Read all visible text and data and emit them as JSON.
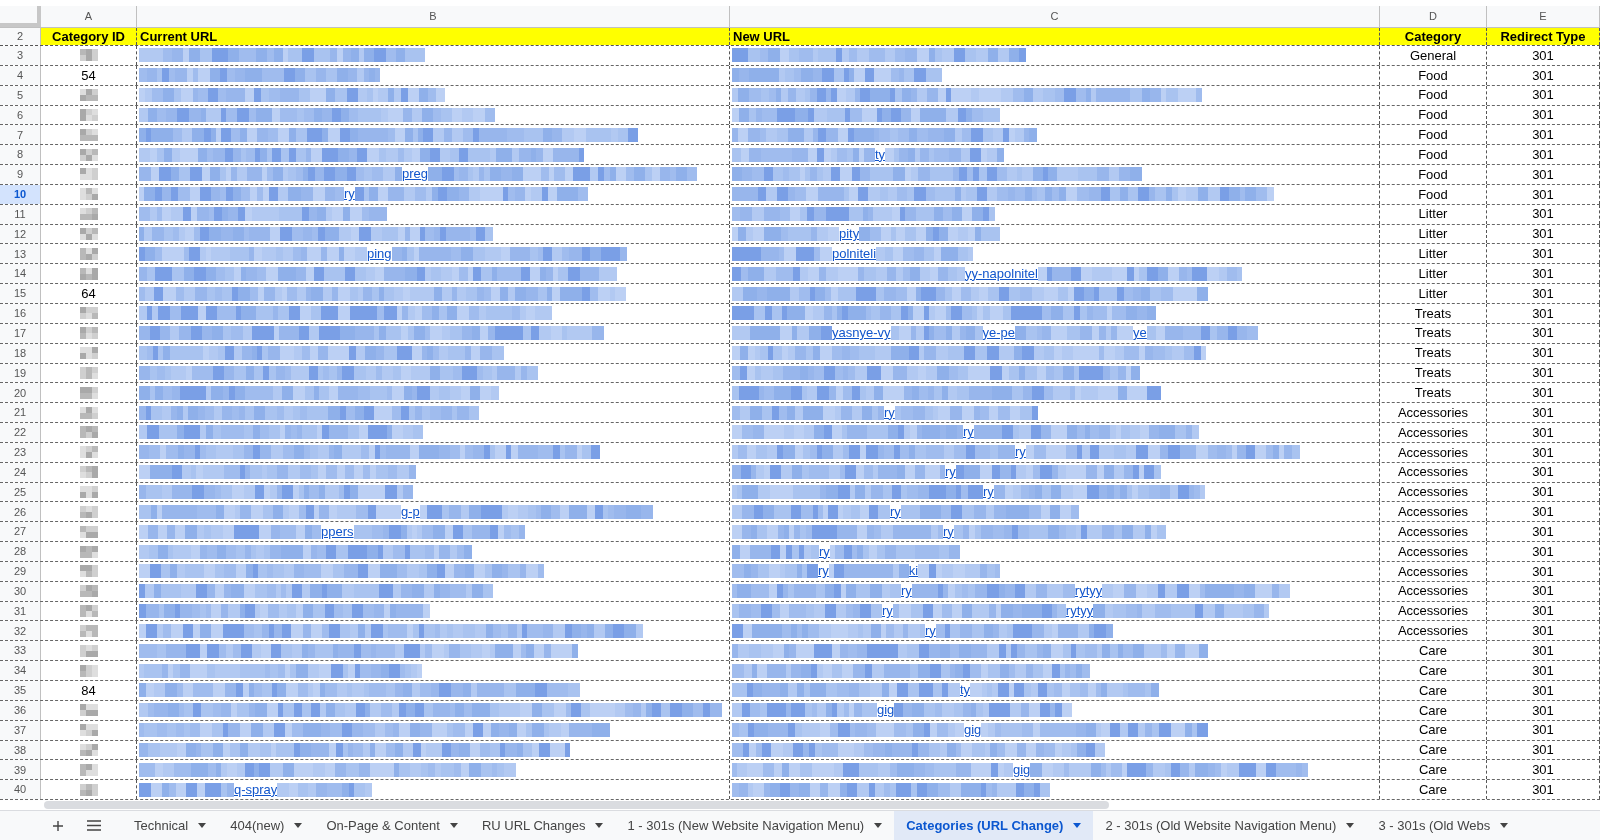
{
  "columns": [
    "A",
    "B",
    "C",
    "D",
    "E"
  ],
  "header": {
    "row": "2",
    "cells": [
      "Category ID",
      "Current URL",
      "New URL",
      "Category",
      "Redirect Type"
    ]
  },
  "rows": [
    {
      "row": "3",
      "selected": false,
      "current_url": [],
      "new_url": [],
      "category": "General",
      "redirect": "301"
    },
    {
      "row": "4",
      "selected": false,
      "category_id": "54",
      "current_url": [],
      "new_url": [],
      "category": "Food",
      "redirect": "301"
    },
    {
      "row": "5",
      "selected": false,
      "current_url": [],
      "new_url": [],
      "category": "Food",
      "redirect": "301"
    },
    {
      "row": "6",
      "selected": false,
      "current_url": [],
      "new_url": [],
      "category": "Food",
      "redirect": "301"
    },
    {
      "row": "7",
      "selected": false,
      "current_url": [],
      "new_url": [],
      "category": "Food",
      "redirect": "301"
    },
    {
      "row": "8",
      "selected": false,
      "current_url": [],
      "new_url": [
        "ty"
      ],
      "category": "Food",
      "redirect": "301"
    },
    {
      "row": "9",
      "selected": false,
      "current_url": [
        "preg"
      ],
      "new_url": [],
      "category": "Food",
      "redirect": "301"
    },
    {
      "row": "10",
      "selected": true,
      "current_url": [
        "ry"
      ],
      "new_url": [],
      "category": "Food",
      "redirect": "301"
    },
    {
      "row": "11",
      "selected": false,
      "current_url": [],
      "new_url": [],
      "category": "Litter",
      "redirect": "301"
    },
    {
      "row": "12",
      "selected": false,
      "current_url": [],
      "new_url": [
        "pity"
      ],
      "category": "Litter",
      "redirect": "301"
    },
    {
      "row": "13",
      "selected": false,
      "current_url": [
        "ping"
      ],
      "new_url": [
        "polniteli"
      ],
      "category": "Litter",
      "redirect": "301"
    },
    {
      "row": "14",
      "selected": false,
      "current_url": [],
      "new_url": [
        "yy-napolnitel"
      ],
      "category": "Litter",
      "redirect": "301"
    },
    {
      "row": "15",
      "selected": false,
      "category_id": "64",
      "current_url": [],
      "new_url": [],
      "category": "Litter",
      "redirect": "301"
    },
    {
      "row": "16",
      "selected": false,
      "current_url": [],
      "new_url": [],
      "category": "Treats",
      "redirect": "301"
    },
    {
      "row": "17",
      "selected": false,
      "current_url": [],
      "new_url": [
        "yasnye-vy",
        "ye-pe",
        "ye"
      ],
      "category": "Treats",
      "redirect": "301"
    },
    {
      "row": "18",
      "selected": false,
      "current_url": [],
      "new_url": [],
      "category": "Treats",
      "redirect": "301"
    },
    {
      "row": "19",
      "selected": false,
      "current_url": [],
      "new_url": [],
      "category": "Treats",
      "redirect": "301"
    },
    {
      "row": "20",
      "selected": false,
      "current_url": [],
      "new_url": [],
      "category": "Treats",
      "redirect": "301"
    },
    {
      "row": "21",
      "selected": false,
      "current_url": [],
      "new_url": [
        "ry"
      ],
      "category": "Accessories",
      "redirect": "301"
    },
    {
      "row": "22",
      "selected": false,
      "current_url": [],
      "new_url": [
        "ry"
      ],
      "category": "Accessories",
      "redirect": "301"
    },
    {
      "row": "23",
      "selected": false,
      "current_url": [],
      "new_url": [
        "ry"
      ],
      "category": "Accessories",
      "redirect": "301"
    },
    {
      "row": "24",
      "selected": false,
      "current_url": [],
      "new_url": [
        "ry"
      ],
      "category": "Accessories",
      "redirect": "301"
    },
    {
      "row": "25",
      "selected": false,
      "current_url": [],
      "new_url": [
        "ry"
      ],
      "category": "Accessories",
      "redirect": "301"
    },
    {
      "row": "26",
      "selected": false,
      "current_url": [
        "g-p"
      ],
      "new_url": [
        "ry"
      ],
      "category": "Accessories",
      "redirect": "301"
    },
    {
      "row": "27",
      "selected": false,
      "current_url": [
        "ppers"
      ],
      "new_url": [
        "ry"
      ],
      "category": "Accessories",
      "redirect": "301"
    },
    {
      "row": "28",
      "selected": false,
      "current_url": [],
      "new_url": [
        "ry"
      ],
      "category": "Accessories",
      "redirect": "301"
    },
    {
      "row": "29",
      "selected": false,
      "current_url": [],
      "new_url": [
        "ry",
        "ki"
      ],
      "category": "Accessories",
      "redirect": "301"
    },
    {
      "row": "30",
      "selected": false,
      "current_url": [],
      "new_url": [
        "ry",
        "rytyy"
      ],
      "category": "Accessories",
      "redirect": "301"
    },
    {
      "row": "31",
      "selected": false,
      "current_url": [],
      "new_url": [
        "ry",
        "rytyy"
      ],
      "category": "Accessories",
      "redirect": "301"
    },
    {
      "row": "32",
      "selected": false,
      "current_url": [],
      "new_url": [
        "ry"
      ],
      "category": "Accessories",
      "redirect": "301"
    },
    {
      "row": "33",
      "selected": false,
      "current_url": [],
      "new_url": [],
      "category": "Care",
      "redirect": "301"
    },
    {
      "row": "34",
      "selected": false,
      "current_url": [],
      "new_url": [],
      "category": "Care",
      "redirect": "301"
    },
    {
      "row": "35",
      "selected": false,
      "category_id": "84",
      "current_url": [],
      "new_url": [
        "ty"
      ],
      "category": "Care",
      "redirect": "301"
    },
    {
      "row": "36",
      "selected": false,
      "current_url": [],
      "new_url": [
        "gig"
      ],
      "category": "Care",
      "redirect": "301"
    },
    {
      "row": "37",
      "selected": false,
      "current_url": [],
      "new_url": [
        "gig"
      ],
      "category": "Care",
      "redirect": "301"
    },
    {
      "row": "38",
      "selected": false,
      "current_url": [],
      "new_url": [],
      "category": "Care",
      "redirect": "301"
    },
    {
      "row": "39",
      "selected": false,
      "current_url": [],
      "new_url": [
        "gig"
      ],
      "category": "Care",
      "redirect": "301"
    },
    {
      "row": "40",
      "selected": false,
      "current_url": [
        "q-spray"
      ],
      "new_url": [],
      "category": "Care",
      "redirect": "301"
    }
  ],
  "sheet_tabs": [
    {
      "label": "Technical",
      "selected": false
    },
    {
      "label": "404(new)",
      "selected": false
    },
    {
      "label": "On-Page & Content",
      "selected": false
    },
    {
      "label": "RU URL Changes",
      "selected": false
    },
    {
      "label": "1 - 301s (New Website Navigation Menu)",
      "selected": false
    },
    {
      "label": "Categories (URL Change)",
      "selected": true
    },
    {
      "label": "2 - 301s (Old Website Navigation Menu)",
      "selected": false
    },
    {
      "label": "3 - 301s (Old Webs",
      "selected": false
    }
  ]
}
